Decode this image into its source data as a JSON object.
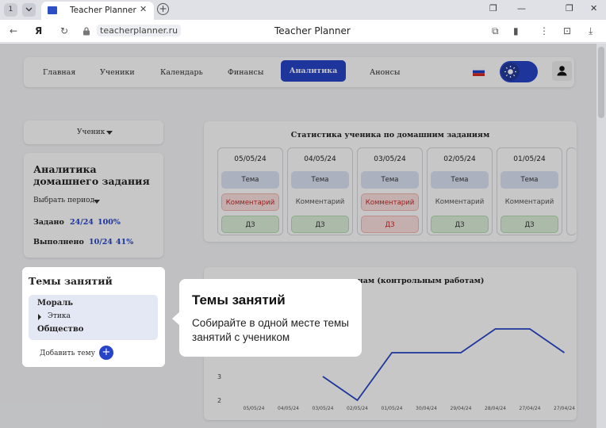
{
  "browser": {
    "tab_count": "1",
    "tab_title": "Teacher Planner",
    "domain": "teacherplanner.ru",
    "page_title": "Teacher Planner"
  },
  "nav": {
    "items": [
      "Главная",
      "Ученики",
      "Календарь",
      "Финансы",
      "Аналитика",
      "Анонсы"
    ],
    "active_index": 4
  },
  "student_select": {
    "label": "Ученик"
  },
  "homework_analytics": {
    "title": "Аналитика домашнего задания",
    "period_label": "Выбрать период",
    "assigned_label": "Задано",
    "assigned_value": "24/24",
    "assigned_percent": "100%",
    "done_label": "Выполнено",
    "done_value": "10/24",
    "done_percent": "41%"
  },
  "homework_stats": {
    "title": "Статистика ученика по домашним заданиям",
    "days": [
      {
        "date": "05/05/24",
        "topic": "Тема",
        "comment": "Комментарий",
        "comment_state": "red",
        "hw": "ДЗ",
        "hw_state": "green"
      },
      {
        "date": "04/05/24",
        "topic": "Тема",
        "comment": "Комментарий",
        "comment_state": "neutral",
        "hw": "ДЗ",
        "hw_state": "green"
      },
      {
        "date": "03/05/24",
        "topic": "Тема",
        "comment": "Комментарий",
        "comment_state": "red",
        "hw": "ДЗ",
        "hw_state": "red"
      },
      {
        "date": "02/05/24",
        "topic": "Тема",
        "comment": "Комментарий",
        "comment_state": "neutral",
        "hw": "ДЗ",
        "hw_state": "green"
      },
      {
        "date": "01/05/24",
        "topic": "Тема",
        "comment": "Комментарий",
        "comment_state": "neutral",
        "hw": "ДЗ",
        "hw_state": "green"
      }
    ]
  },
  "exam_chart": {
    "title_visible": "...ным экзаменам (контрольным работам)",
    "line_color": "#2744c8"
  },
  "chart_data": {
    "type": "line",
    "title": "...ным экзаменам (контрольным работам)",
    "categories": [
      "05/05/24",
      "04/05/24",
      "03/05/24",
      "02/05/24",
      "01/05/24",
      "30/04/24",
      "29/04/24",
      "28/04/24",
      "27/04/24",
      "27/04/24"
    ],
    "values": [
      null,
      null,
      3,
      2,
      4,
      4,
      4,
      5,
      5,
      4
    ],
    "y_tick_labels": [
      "3",
      "2"
    ],
    "ylim": [
      1.6,
      5.6
    ]
  },
  "topics_panel": {
    "title": "Темы занятий",
    "topics": [
      {
        "name": "Мораль",
        "level": 0
      },
      {
        "name": "Этика",
        "level": 1
      },
      {
        "name": "Общество",
        "level": 0
      }
    ],
    "add_label": "Добавить тему"
  },
  "tooltip": {
    "title": "Темы занятий",
    "text": "Собирайте в одной месте темы занятий с учеником"
  }
}
